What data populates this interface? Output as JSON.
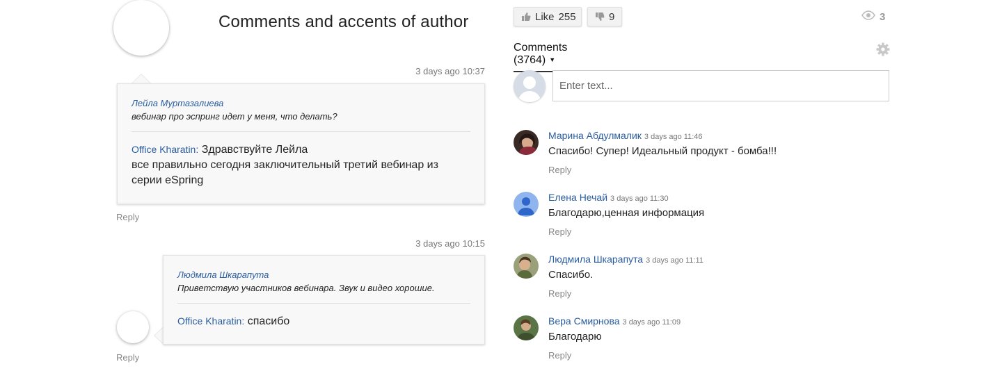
{
  "author_panel": {
    "title": "Comments and accents of author",
    "threads": [
      {
        "timestamp": "3 days ago 10:37",
        "quote_author": "Лейла Муртазалиева",
        "quote_text": "вебинар про эспринг идет у меня, что делать?",
        "answer_author": "Office Kharatin:",
        "answer_text_line1": "Здравствуйте Лейла",
        "answer_text_rest": "все правильно сегодня заключительный третий вебинар из серии eSpring",
        "reply_label": "Reply"
      },
      {
        "timestamp": "3 days ago 10:15",
        "quote_author": "Людмила Шкарапута",
        "quote_text": "Приветствую участников вебинара. Звук и видео хорошие.",
        "answer_author": "Office Kharatin:",
        "answer_text_line1": "спасибо",
        "reply_label": "Reply"
      }
    ]
  },
  "toolbar": {
    "like_label": "Like",
    "like_count": "255",
    "dislike_count": "9",
    "views_count": "3"
  },
  "comments": {
    "tab_label": "Comments (3764)",
    "input_placeholder": "Enter text...",
    "items": [
      {
        "name": "Марина Абдулмалик",
        "time": "3 days ago 11:46",
        "text": "Спасибо! Супер! Идеальный продукт - бомба!!!",
        "reply": "Reply"
      },
      {
        "name": "Елена Нечай",
        "time": "3 days ago 11:30",
        "text": "Благодарю,ценная информация",
        "reply": "Reply"
      },
      {
        "name": "Людмила Шкарапута",
        "time": "3 days ago 11:11",
        "text": "Спасибо.",
        "reply": "Reply"
      },
      {
        "name": "Вера Смирнова",
        "time": "3 days ago 11:09",
        "text": "Благодарю",
        "reply": "Reply"
      }
    ]
  },
  "colors": {
    "link_blue": "#2a5d9f",
    "muted_gray": "#888888",
    "card_bg": "#f8f8f8"
  },
  "icons": {
    "like": "thumbs-up-icon",
    "dislike": "thumbs-down-icon",
    "views": "eye-icon",
    "settings": "gear-icon",
    "tab_menu": "caret-down-icon"
  }
}
